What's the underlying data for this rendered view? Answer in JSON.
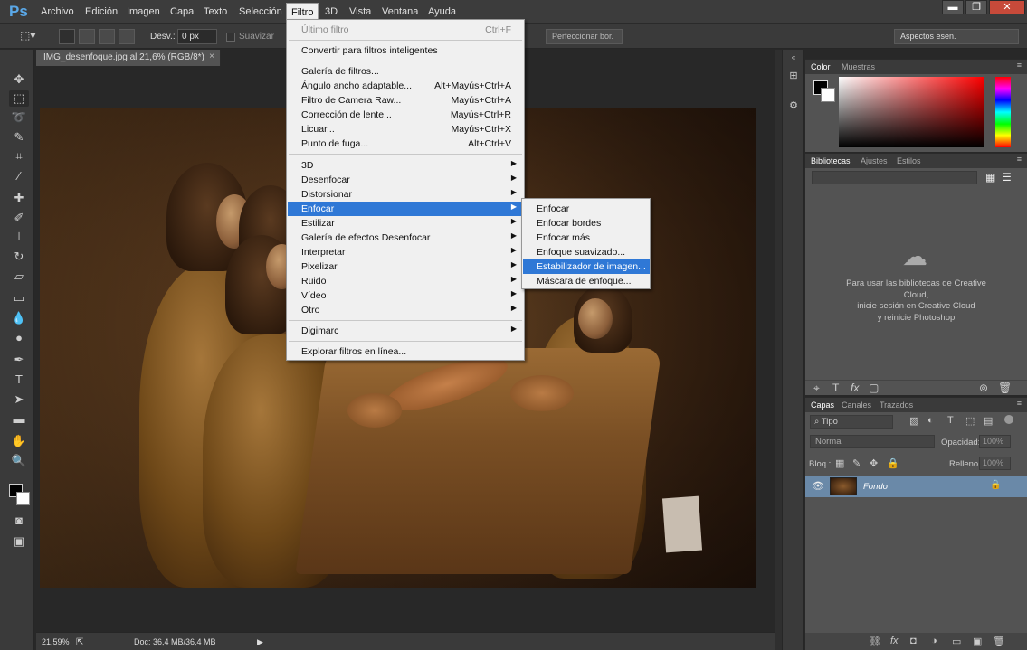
{
  "app": {
    "logo": "Ps"
  },
  "menubar": {
    "items": [
      "Archivo",
      "Edición",
      "Imagen",
      "Capa",
      "Texto",
      "Selección",
      "Filtro",
      "3D",
      "Vista",
      "Ventana",
      "Ayuda"
    ],
    "active": "Filtro",
    "window_buttons": [
      "▬",
      "❐",
      "✕"
    ]
  },
  "options": {
    "desv_label": "Desv.:",
    "desv_value": "0 px",
    "suavizar": "Suavizar",
    "refine_button": "Perfeccionar bor.",
    "workspace": "Aspectos esen."
  },
  "document": {
    "tab_title": "IMG_desenfoque.jpg al 21,6% (RGB/8*)",
    "close": "×",
    "zoom": "21,59%",
    "doc_info": "Doc: 36,4 MB/36,4 MB"
  },
  "filter_menu": {
    "items": [
      {
        "label": "Último filtro",
        "shortcut": "Ctrl+F",
        "disabled": true
      },
      {
        "label": "Convertir para filtros inteligentes",
        "shortcut": ""
      },
      {
        "label": "Galería de filtros...",
        "shortcut": ""
      },
      {
        "label": "Ángulo ancho adaptable...",
        "shortcut": "Alt+Mayús+Ctrl+A"
      },
      {
        "label": "Filtro de Camera Raw...",
        "shortcut": "Mayús+Ctrl+A"
      },
      {
        "label": "Corrección de lente...",
        "shortcut": "Mayús+Ctrl+R"
      },
      {
        "label": "Licuar...",
        "shortcut": "Mayús+Ctrl+X"
      },
      {
        "label": "Punto de fuga...",
        "shortcut": "Alt+Ctrl+V"
      },
      {
        "label": "3D",
        "submenu": true
      },
      {
        "label": "Desenfocar",
        "submenu": true
      },
      {
        "label": "Distorsionar",
        "submenu": true
      },
      {
        "label": "Enfocar",
        "submenu": true,
        "highlighted": true
      },
      {
        "label": "Estilizar",
        "submenu": true
      },
      {
        "label": "Galería de efectos Desenfocar",
        "submenu": true
      },
      {
        "label": "Interpretar",
        "submenu": true
      },
      {
        "label": "Pixelizar",
        "submenu": true
      },
      {
        "label": "Ruido",
        "submenu": true
      },
      {
        "label": "Vídeo",
        "submenu": true
      },
      {
        "label": "Otro",
        "submenu": true
      },
      {
        "label": "Digimarc",
        "submenu": true
      },
      {
        "label": "Explorar filtros en línea...",
        "shortcut": ""
      }
    ]
  },
  "enfocar_submenu": {
    "items": [
      "Enfocar",
      "Enfocar bordes",
      "Enfocar más",
      "Enfoque suavizado...",
      "Estabilizador de imagen...",
      "Máscara de enfoque..."
    ],
    "highlighted": "Estabilizador de imagen..."
  },
  "color_panel": {
    "tabs": [
      "Color",
      "Muestras"
    ]
  },
  "libraries_panel": {
    "tabs": [
      "Bibliotecas",
      "Ajustes",
      "Estilos"
    ],
    "message_lines": [
      "Para usar las bibliotecas de Creative",
      "Cloud,",
      "inicie sesión en Creative Cloud",
      "y reinicie Photoshop"
    ]
  },
  "layers_panel": {
    "tabs": [
      "Capas",
      "Canales",
      "Trazados"
    ],
    "filter_kind": "Tipo",
    "blend_mode": "Normal",
    "opacity_label": "Opacidad:",
    "opacity_value": "100%",
    "lock_label": "Bloq.:",
    "fill_label": "Relleno:",
    "fill_value": "100%",
    "layer_name": "Fondo"
  },
  "colors": {
    "accent": "#2f78d6",
    "layer_selected": "#6a89a8"
  }
}
